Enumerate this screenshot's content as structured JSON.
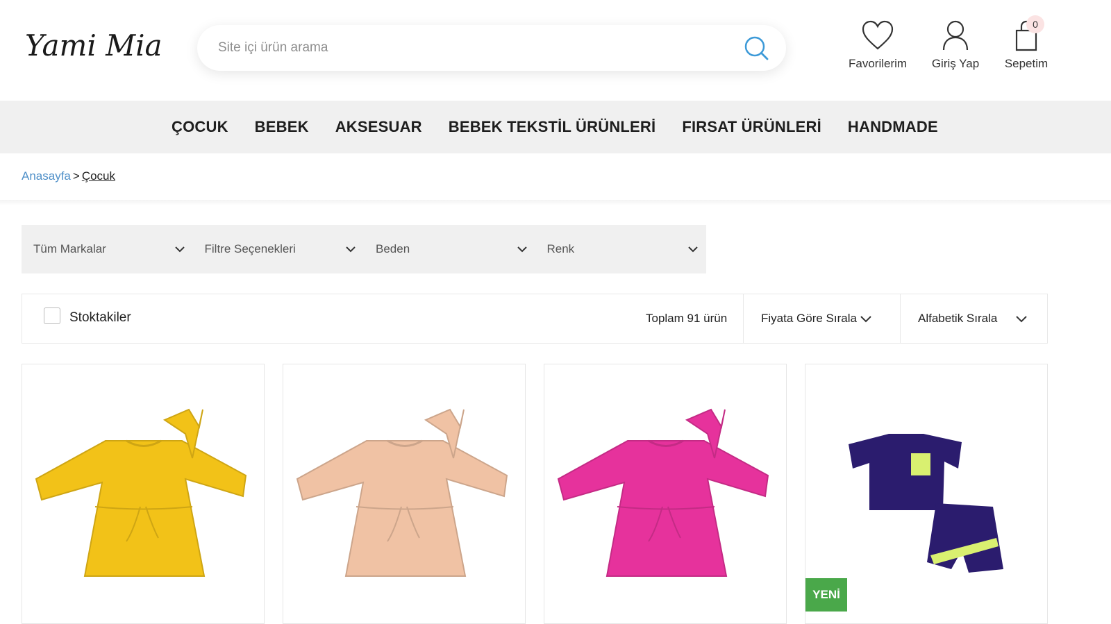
{
  "header": {
    "logo_text": "Yami Mia",
    "search_placeholder": "Site içi ürün arama",
    "favorites_label": "Favorilerim",
    "login_label": "Giriş Yap",
    "cart_label": "Sepetim",
    "cart_count": "0"
  },
  "nav": {
    "items": [
      "ÇOCUK",
      "BEBEK",
      "AKSESUAR",
      "BEBEK TEKSTİL ÜRÜNLERİ",
      "FIRSAT ÜRÜNLERİ",
      "HANDMADE"
    ]
  },
  "breadcrumb": {
    "home": "Anasayfa",
    "separator": ">",
    "current": "Çocuk"
  },
  "filters": [
    "Tüm Markalar",
    "Filtre Seçenekleri",
    "Beden",
    "Renk"
  ],
  "toolbar": {
    "in_stock_label": "Stoktakiler",
    "in_stock_checked": false,
    "total_text": "Toplam 91 ürün",
    "sort_price": "Fiyata Göre Sırala",
    "sort_alpha": "Alfabetik Sırala"
  },
  "products": [
    {
      "image": "yellow-dress-with-headband",
      "color": "#f2c218",
      "badge": ""
    },
    {
      "image": "peach-dress-with-headband",
      "color": "#f0c2a4",
      "badge": ""
    },
    {
      "image": "pink-dress-with-headband",
      "color": "#e6329c",
      "badge": ""
    },
    {
      "image": "navy-tshirt-and-shorts-set",
      "color": "#2b1c6e",
      "accent": "#d9f070",
      "badge": "YENİ"
    }
  ],
  "colors": {
    "nav_bg": "#f0f0f0",
    "link_blue": "#4e8fc8",
    "badge_green": "#4aa84a",
    "cart_badge_bg": "#fbe3e3"
  }
}
